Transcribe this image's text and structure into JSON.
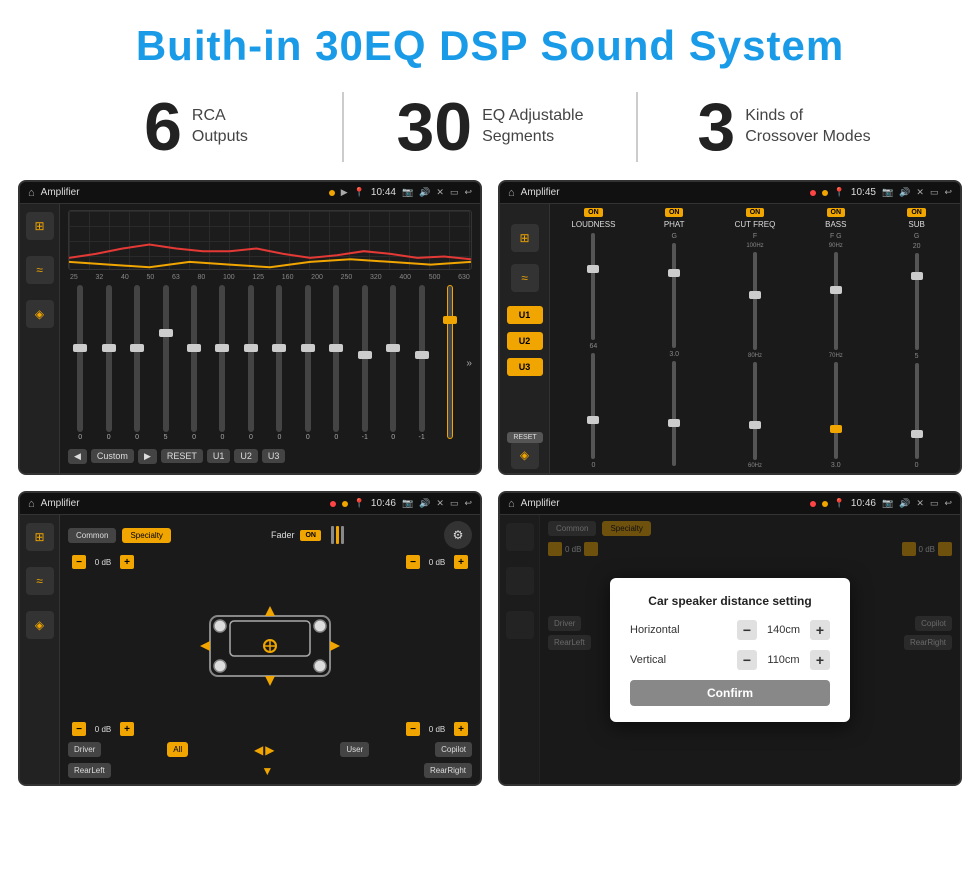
{
  "page": {
    "title": "Buith-in 30EQ DSP Sound System"
  },
  "stats": [
    {
      "number": "6",
      "label_line1": "RCA",
      "label_line2": "Outputs"
    },
    {
      "number": "30",
      "label_line1": "EQ Adjustable",
      "label_line2": "Segments"
    },
    {
      "number": "3",
      "label_line1": "Kinds of",
      "label_line2": "Crossover Modes"
    }
  ],
  "screens": [
    {
      "id": "eq-screen",
      "status_bar": {
        "title": "Amplifier",
        "time": "10:44"
      },
      "freq_labels": [
        "25",
        "32",
        "40",
        "50",
        "63",
        "80",
        "100",
        "125",
        "160",
        "200",
        "250",
        "320",
        "400",
        "500",
        "630"
      ],
      "slider_values": [
        "0",
        "0",
        "0",
        "5",
        "0",
        "0",
        "0",
        "0",
        "0",
        "0",
        "0",
        "-1",
        "0",
        "-1"
      ],
      "bottom_buttons": [
        "Custom",
        "RESET",
        "U1",
        "U2",
        "U3"
      ]
    },
    {
      "id": "crossover-screen",
      "status_bar": {
        "title": "Amplifier",
        "time": "10:45"
      },
      "u_buttons": [
        "U1",
        "U2",
        "U3"
      ],
      "channels": [
        "LOUDNESS",
        "PHAT",
        "CUT FREQ",
        "BASS",
        "SUB"
      ]
    },
    {
      "id": "fader-screen",
      "status_bar": {
        "title": "Amplifier",
        "time": "10:46"
      },
      "tabs": [
        "Common",
        "Specialty"
      ],
      "fader_label": "Fader",
      "db_values": [
        "0 dB",
        "0 dB",
        "0 dB",
        "0 dB"
      ],
      "bottom_buttons": [
        "Driver",
        "All",
        "User",
        "Copilot",
        "RearLeft",
        "RearRight"
      ]
    },
    {
      "id": "dialog-screen",
      "status_bar": {
        "title": "Amplifier",
        "time": "10:46"
      },
      "tabs": [
        "Common",
        "Specialty"
      ],
      "dialog": {
        "title": "Car speaker distance setting",
        "horizontal_label": "Horizontal",
        "horizontal_value": "140cm",
        "vertical_label": "Vertical",
        "vertical_value": "110cm",
        "confirm_label": "Confirm"
      },
      "db_values": [
        "0 dB",
        "0 dB"
      ],
      "bottom_buttons": [
        "Driver",
        "Copilot",
        "RearLeft",
        "RearRight"
      ]
    }
  ]
}
